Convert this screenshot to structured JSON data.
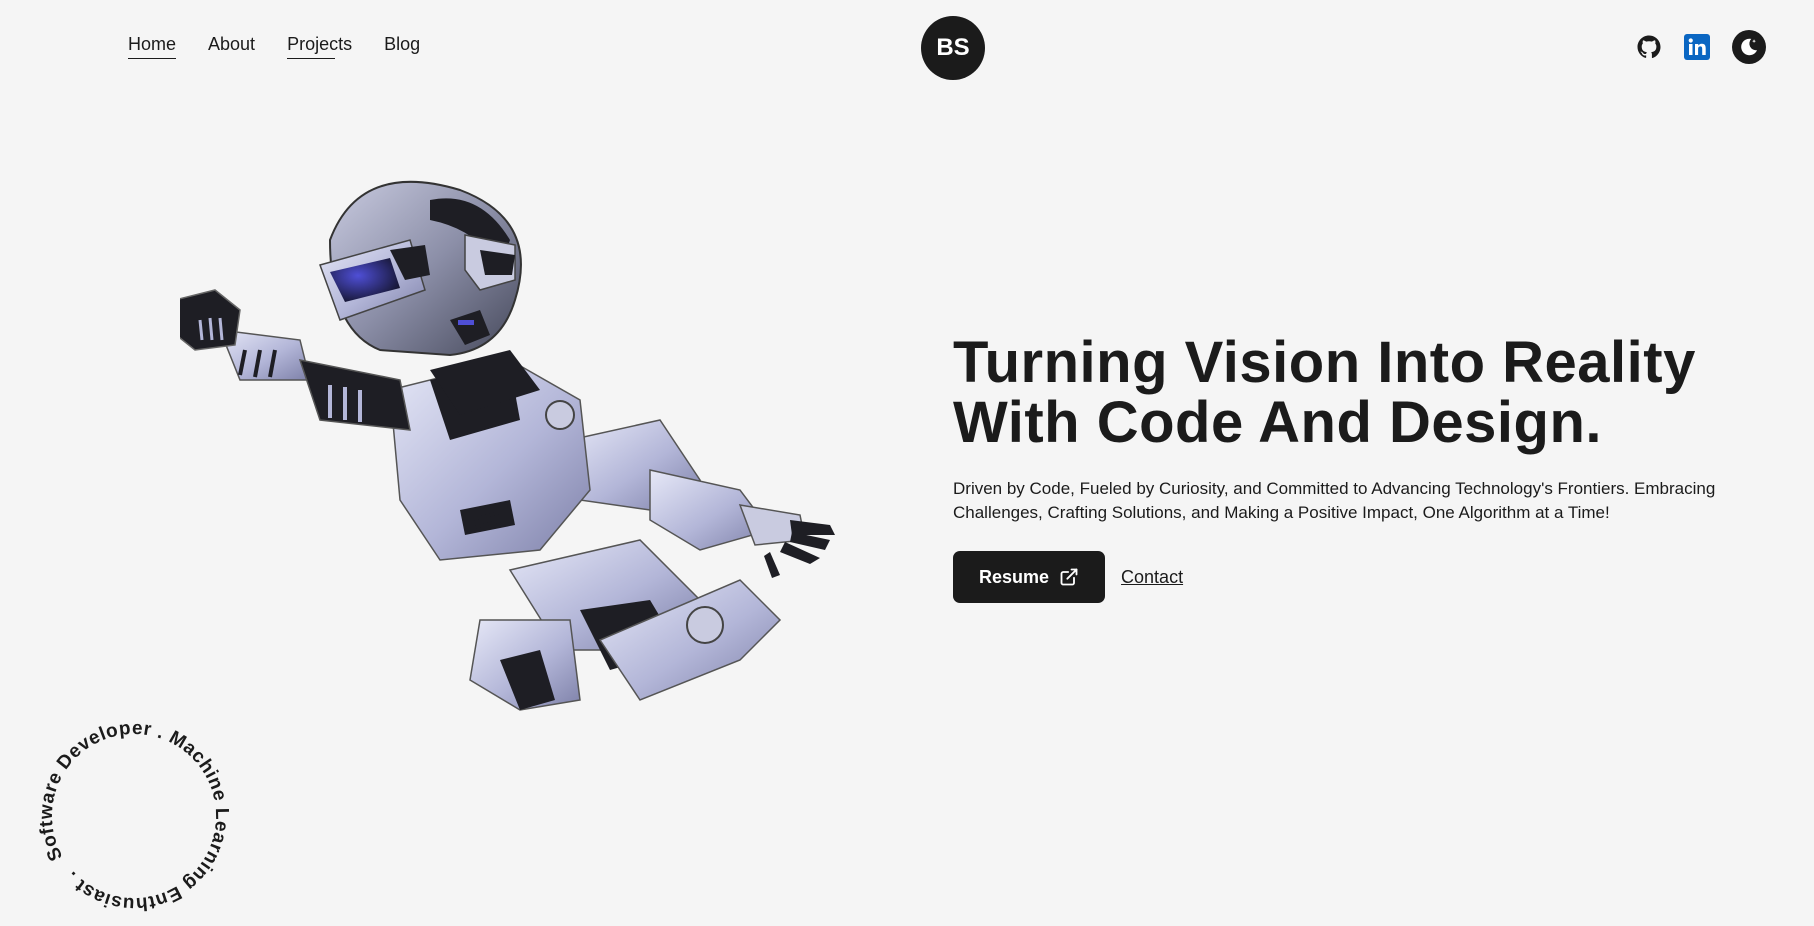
{
  "nav": {
    "items": [
      {
        "label": "Home"
      },
      {
        "label": "About"
      },
      {
        "label": "Projects"
      },
      {
        "label": "Blog"
      }
    ]
  },
  "logo": {
    "text": "BS"
  },
  "socials": {
    "icons": [
      "github-icon",
      "linkedin-icon",
      "moon-icon"
    ],
    "linkedin_color": "#0a66c2"
  },
  "hero": {
    "title": "Turning Vision Into Reality With Code And Design.",
    "description": "Driven by Code, Fueled by Curiosity, and Committed to Advancing Technology's Frontiers. Embracing Challenges, Crafting Solutions, and Making a Positive Impact, One Algorithm at a Time!",
    "resume_label": "Resume",
    "contact_label": "Contact"
  },
  "badge": {
    "text": "Software Developer . Machine Learning Enthusiast ."
  },
  "colors": {
    "background": "#f5f5f5",
    "dark": "#1b1b1b"
  }
}
